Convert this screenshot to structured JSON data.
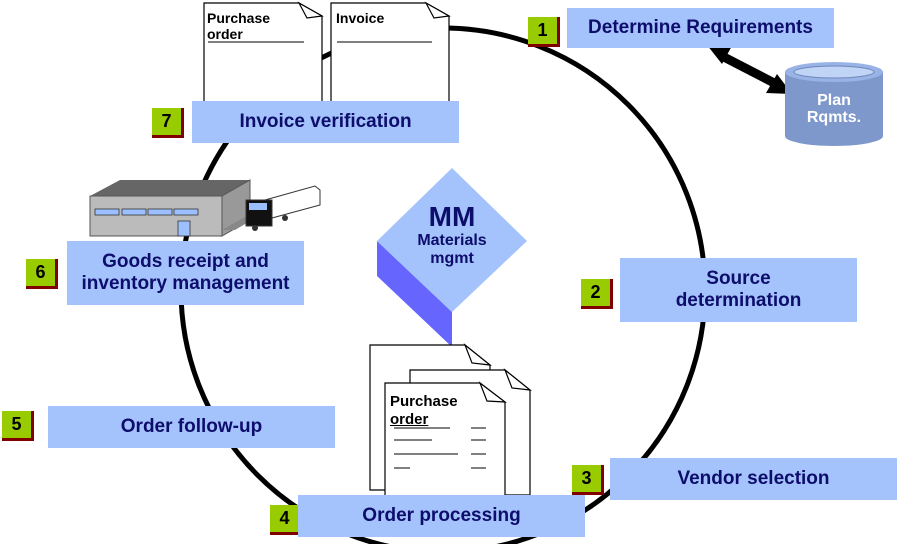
{
  "diagram": {
    "center": {
      "title": "MM",
      "subtitle_line1": "Materials",
      "subtitle_line2": "mgmt"
    },
    "steps": [
      {
        "number": "1",
        "label": "Determine Requirements"
      },
      {
        "number": "2",
        "label_line1": "Source",
        "label_line2": "determination"
      },
      {
        "number": "3",
        "label": "Vendor selection"
      },
      {
        "number": "4",
        "label": "Order processing"
      },
      {
        "number": "5",
        "label": "Order follow-up"
      },
      {
        "number": "6",
        "label_line1": "Goods receipt and",
        "label_line2": "inventory management"
      },
      {
        "number": "7",
        "label": "Invoice verification"
      }
    ],
    "database": {
      "line1": "Plan",
      "line2": "Rqmts."
    },
    "top_docs": [
      {
        "line1": "Purchase",
        "line2": "order"
      },
      {
        "line1": "Invoice",
        "line2": ""
      }
    ],
    "center_doc": {
      "line1": "Purchase",
      "line2": "order"
    },
    "colors": {
      "box": "#a4c2fb",
      "box_text": "#0d0d6b",
      "number_bg": "#99cc00",
      "number_shadow": "#800000",
      "diamond_top": "#a4c2fb",
      "diamond_side": "#6666ff"
    }
  }
}
